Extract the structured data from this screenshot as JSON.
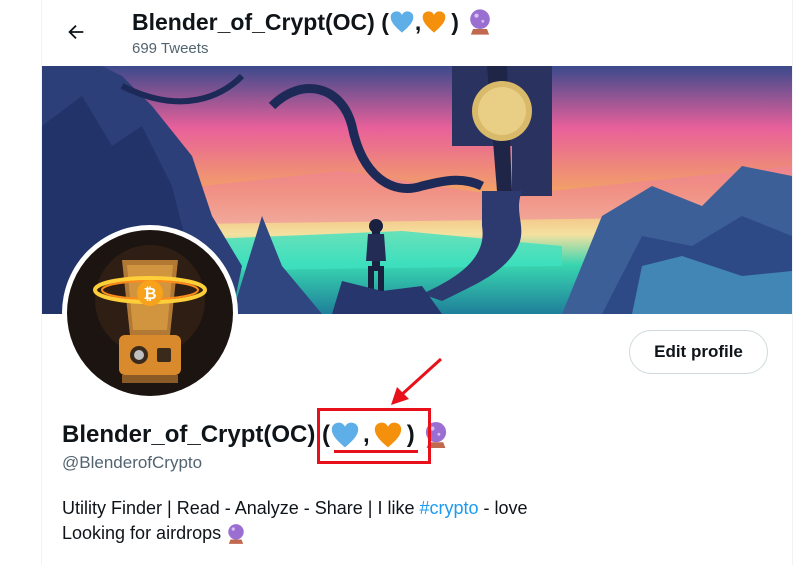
{
  "header": {
    "title": "Blender_of_Crypt(OC) (",
    "title_sep": ",",
    "title_end": ")",
    "tweet_count": "699 Tweets"
  },
  "profile": {
    "display_name": "Blender_of_Crypt(OC) (",
    "name_sep": ",",
    "name_end": ")",
    "handle": "@BlenderofCrypto",
    "edit_button": "Edit profile",
    "bio_line1_prefix": "Utility Finder | Read - Analyze - Share | I like ",
    "bio_hashtag": "#crypto",
    "bio_line1_suffix": " - love",
    "bio_line2": "Looking for airdrops "
  },
  "icons": [
    "back-arrow-icon",
    "blue-heart-icon",
    "orange-heart-icon",
    "crystal-ball-icon",
    "bitcoin-icon"
  ],
  "colors": {
    "accent": "#1d9bf0",
    "annotation": "#e8111b",
    "muted": "#536471",
    "blue_heart": "#5eaee8",
    "orange_heart": "#f4900c",
    "crystal_ball": "#9b6fd1"
  }
}
